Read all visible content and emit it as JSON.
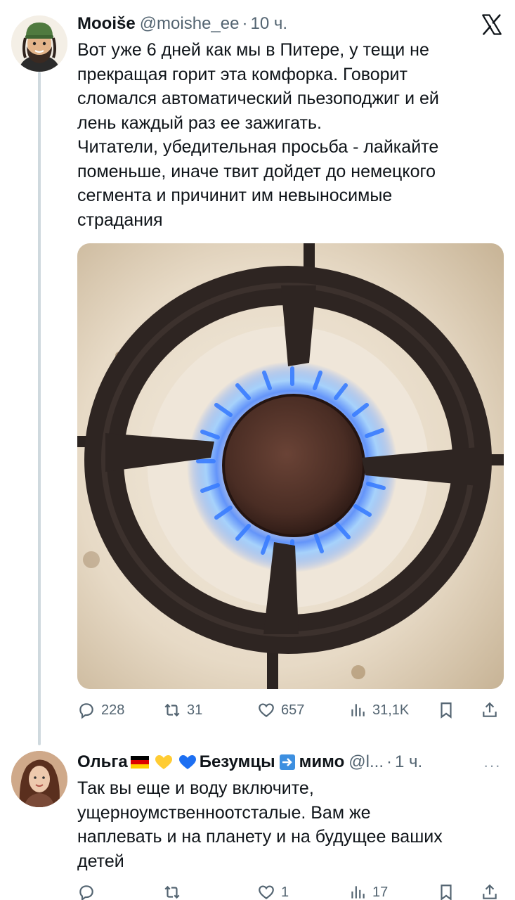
{
  "tweet": {
    "author_name": "Mooiše",
    "author_handle": "@moishe_ee",
    "separator": "·",
    "time": "10 ч.",
    "text": "Вот уже 6 дней как мы в Питере, у тещи не\nпрекращая горит эта комфорка. Говорит\nсломался автоматический пьезоподжиг и ей\nлень каждый раз ее зажигать.\nЧитатели, убедительная просьба - лайкайте\nпоменьше, иначе твит дойдет до немецкого\nсегмента и причинит им невыносимые\nстрадания",
    "media_description_icon": "gas-burner-photo",
    "stats": {
      "replies": "228",
      "reposts": "31",
      "likes": "657",
      "views": "31,1K"
    }
  },
  "reply": {
    "author_name_part1": "Ольга",
    "author_name_part2": "Безумцы",
    "author_name_part3": "мимо",
    "emojis": [
      "germany-flag",
      "yellow-heart",
      "blue-heart",
      "right-arrow"
    ],
    "author_handle": "@l...",
    "separator": "·",
    "time": "1 ч.",
    "more": "···",
    "text": "Так вы еще и воду включите,\nущерноумственноотсталые. Вам же\nнаплевать и на планету и на будущее ваших\nдетей",
    "stats": {
      "replies": "",
      "reposts": "",
      "likes": "1",
      "views": "17"
    }
  },
  "colors": {
    "text": "#0f1419",
    "secondary": "#536471",
    "thread_line": "#cfd9de",
    "flame": "#3b7bff"
  }
}
